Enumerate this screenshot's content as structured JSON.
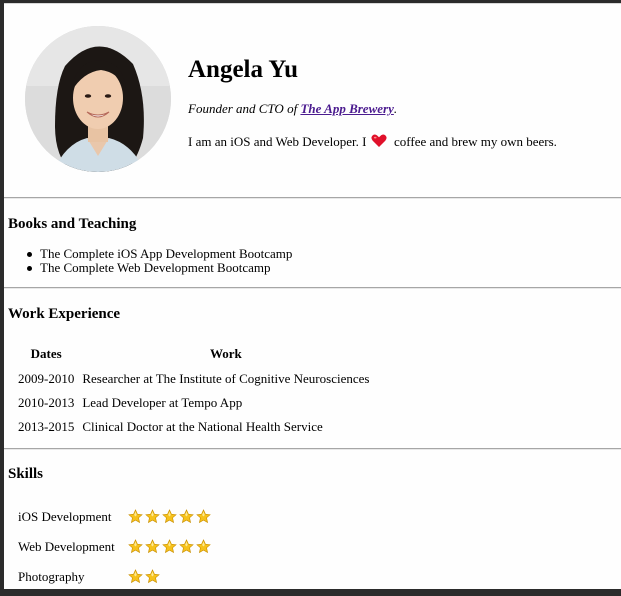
{
  "profile": {
    "name": "Angela Yu",
    "tagline_prefix": "Founder and CTO of ",
    "company": "The App Brewery",
    "tagline_suffix": ".",
    "bio_before": "I am an iOS and Web Developer. I",
    "bio_after": "coffee and brew my own beers."
  },
  "books": {
    "title": "Books and Teaching",
    "items": [
      "The Complete iOS App Development Bootcamp",
      "The Complete Web Development Bootcamp"
    ]
  },
  "work": {
    "title": "Work Experience",
    "headers": [
      "Dates",
      "Work"
    ],
    "rows": [
      {
        "dates": "2009-2010",
        "work": "Researcher at The Institute of Cognitive Neurosciences"
      },
      {
        "dates": "2010-2013",
        "work": "Lead Developer at Tempo App"
      },
      {
        "dates": "2013-2015",
        "work": "Clinical Doctor at the National Health Service"
      }
    ]
  },
  "skills": {
    "title": "Skills",
    "items": [
      {
        "name": "iOS Development",
        "stars": 5
      },
      {
        "name": "Web Development",
        "stars": 5
      },
      {
        "name": "Photography",
        "stars": 2
      }
    ]
  },
  "colors": {
    "link": "#4b1b8f",
    "heart": "#e0102a",
    "star": "#f6c21c"
  }
}
